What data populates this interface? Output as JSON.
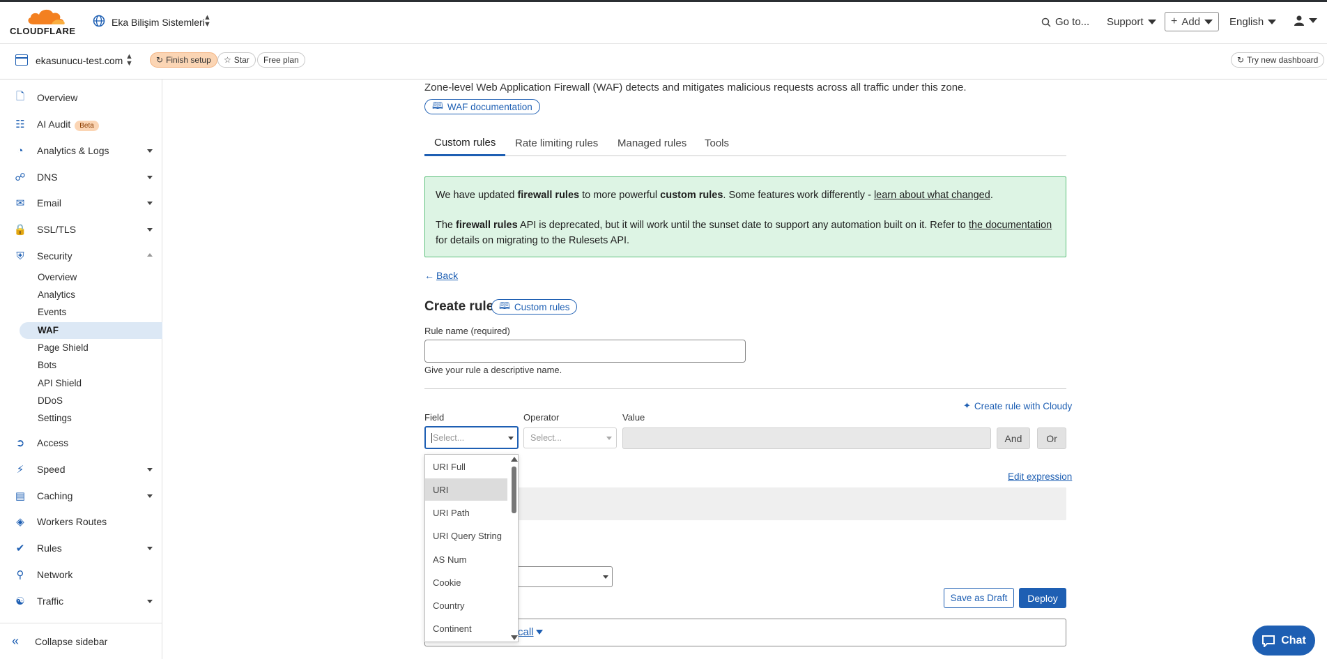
{
  "header": {
    "logo_text": "CLOUDFLARE",
    "account_name": "Eka Bilişim Sistemleri",
    "goto_label": "Go to...",
    "support_label": "Support",
    "add_label": "Add",
    "language_label": "English"
  },
  "zone": {
    "name": "ekasunucu-test.com",
    "finish_setup": "Finish setup",
    "star": "Star",
    "plan": "Free plan",
    "try_new": "Try new dashboard"
  },
  "sidebar": {
    "items": [
      {
        "label": "Overview",
        "icon": "document-icon"
      },
      {
        "label": "AI Audit",
        "icon": "robot-icon",
        "badge": "Beta"
      },
      {
        "label": "Analytics & Logs",
        "icon": "chart-icon"
      },
      {
        "label": "DNS",
        "icon": "network-icon"
      },
      {
        "label": "Email",
        "icon": "email-icon"
      },
      {
        "label": "SSL/TLS",
        "icon": "lock-icon"
      },
      {
        "label": "Security",
        "icon": "shield-icon"
      },
      {
        "label": "Access",
        "icon": "access-icon"
      },
      {
        "label": "Speed",
        "icon": "lightning-icon"
      },
      {
        "label": "Caching",
        "icon": "storage-icon"
      },
      {
        "label": "Workers Routes",
        "icon": "workers-icon"
      },
      {
        "label": "Rules",
        "icon": "rules-icon"
      },
      {
        "label": "Network",
        "icon": "location-icon"
      },
      {
        "label": "Traffic",
        "icon": "traffic-icon"
      }
    ],
    "security_sub": [
      "Overview",
      "Analytics",
      "Events",
      "WAF",
      "Page Shield",
      "Bots",
      "API Shield",
      "DDoS",
      "Settings"
    ],
    "collapse_label": "Collapse sidebar"
  },
  "main": {
    "description": "Zone-level Web Application Firewall (WAF) detects and mitigates malicious requests across all traffic under this zone.",
    "waf_doc": "WAF documentation",
    "tabs": [
      "Custom rules",
      "Rate limiting rules",
      "Managed rules",
      "Tools"
    ],
    "notice": {
      "l1_a": "We have updated ",
      "l1_b": "firewall rules",
      "l1_c": " to more powerful ",
      "l1_d": "custom rules",
      "l1_e": ". Some features work differently - ",
      "l1_link": "learn about what changed",
      "l1_f": ".",
      "l2_a": "The ",
      "l2_b": "firewall rules",
      "l2_c": " API is deprecated, but it will work until the sunset date to support any automation built on it. Refer to ",
      "l2_link": "the documentation",
      "l3": "for details on migrating to the Rulesets API."
    },
    "back": "Back",
    "create_rule_title": "Create rule",
    "custom_rules_btn": "Custom rules",
    "rule_name_label": "Rule name (required)",
    "rule_name_value": "",
    "rule_name_help": "Give your rule a descriptive name.",
    "cloudy_link": "Create rule with Cloudy",
    "field_label": "Field",
    "operator_label": "Operator",
    "value_label": "Value",
    "field_placeholder": "Select...",
    "operator_placeholder": "Select...",
    "and_btn": "And",
    "or_btn": "Or",
    "edit_expression": "Edit expression",
    "dropdown_options": [
      "URI Full",
      "URI",
      "URI Path",
      "URI Query String",
      "AS Num",
      "Cookie",
      "Country",
      "Continent"
    ],
    "save_draft": "Save as Draft",
    "deploy": "Deploy",
    "partial_link": "call",
    "chat": "Chat"
  }
}
